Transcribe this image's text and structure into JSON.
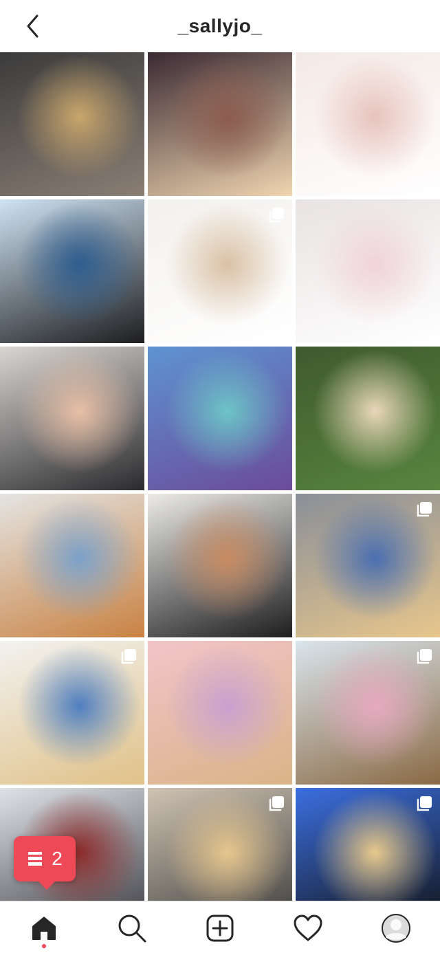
{
  "header": {
    "title": "_sallyjo_"
  },
  "icons": {
    "back": "chevron-left-icon",
    "multi_post": "carousel-icon",
    "notification": "comment-notification-icon",
    "home": "home-icon",
    "search": "search-icon",
    "new_post": "add-post-icon",
    "activity": "heart-icon",
    "profile": "profile-avatar-icon"
  },
  "notification": {
    "count": "2"
  },
  "colors": {
    "accent": "#ed4956",
    "text": "#262626",
    "border": "#dbdbdb"
  },
  "posts": [
    {
      "kind": "photo",
      "multi": false,
      "palette": [
        "#3b3b3b",
        "#c9a66b",
        "#8a7e74"
      ]
    },
    {
      "kind": "photo",
      "multi": false,
      "palette": [
        "#3a2a33",
        "#8c5c4f",
        "#f0d5b0"
      ]
    },
    {
      "kind": "photo",
      "multi": false,
      "palette": [
        "#f4e9e4",
        "#e7c3bd",
        "#ffffff"
      ]
    },
    {
      "kind": "photo",
      "multi": false,
      "palette": [
        "#cfe3f3",
        "#2d5d8f",
        "#1d1d1f"
      ]
    },
    {
      "kind": "photo",
      "multi": true,
      "palette": [
        "#f3f1ee",
        "#d9c1a5",
        "#ffffff"
      ]
    },
    {
      "kind": "photo",
      "multi": false,
      "palette": [
        "#e9e3e3",
        "#f0d3d8",
        "#ffffff"
      ]
    },
    {
      "kind": "photo",
      "multi": false,
      "palette": [
        "#d9d6d2",
        "#e8bfa5",
        "#2b2b2e"
      ]
    },
    {
      "kind": "photo",
      "multi": false,
      "palette": [
        "#5e93d1",
        "#6dc4c6",
        "#6b4b9a"
      ]
    },
    {
      "kind": "photo",
      "multi": false,
      "palette": [
        "#3f5a2e",
        "#e9d7b9",
        "#58853f"
      ]
    },
    {
      "kind": "photo",
      "multi": false,
      "palette": [
        "#e4e4e2",
        "#7ba1c9",
        "#c98243"
      ]
    },
    {
      "kind": "photo",
      "multi": false,
      "palette": [
        "#ecebe8",
        "#c98c62",
        "#1e1e20"
      ]
    },
    {
      "kind": "photo",
      "multi": true,
      "palette": [
        "#8a8f98",
        "#4a6fb0",
        "#e7c68c"
      ]
    },
    {
      "kind": "photo",
      "multi": true,
      "palette": [
        "#f2f2f0",
        "#4f7fbf",
        "#e0c188"
      ]
    },
    {
      "kind": "photo",
      "multi": false,
      "palette": [
        "#f2c4c9",
        "#c9a0d0",
        "#d9b487"
      ]
    },
    {
      "kind": "photo",
      "multi": true,
      "palette": [
        "#d9e4ec",
        "#e7a9c0",
        "#8a6a45"
      ]
    },
    {
      "kind": "photo",
      "multi": false,
      "palette": [
        "#dfe3e8",
        "#8c2b2b",
        "#3b3b40"
      ]
    },
    {
      "kind": "photo",
      "multi": true,
      "palette": [
        "#cfc3b2",
        "#e6c68d",
        "#3a3a3a"
      ]
    },
    {
      "kind": "photo",
      "multi": true,
      "palette": [
        "#3b6fe0",
        "#e7c98c",
        "#111111"
      ]
    }
  ]
}
